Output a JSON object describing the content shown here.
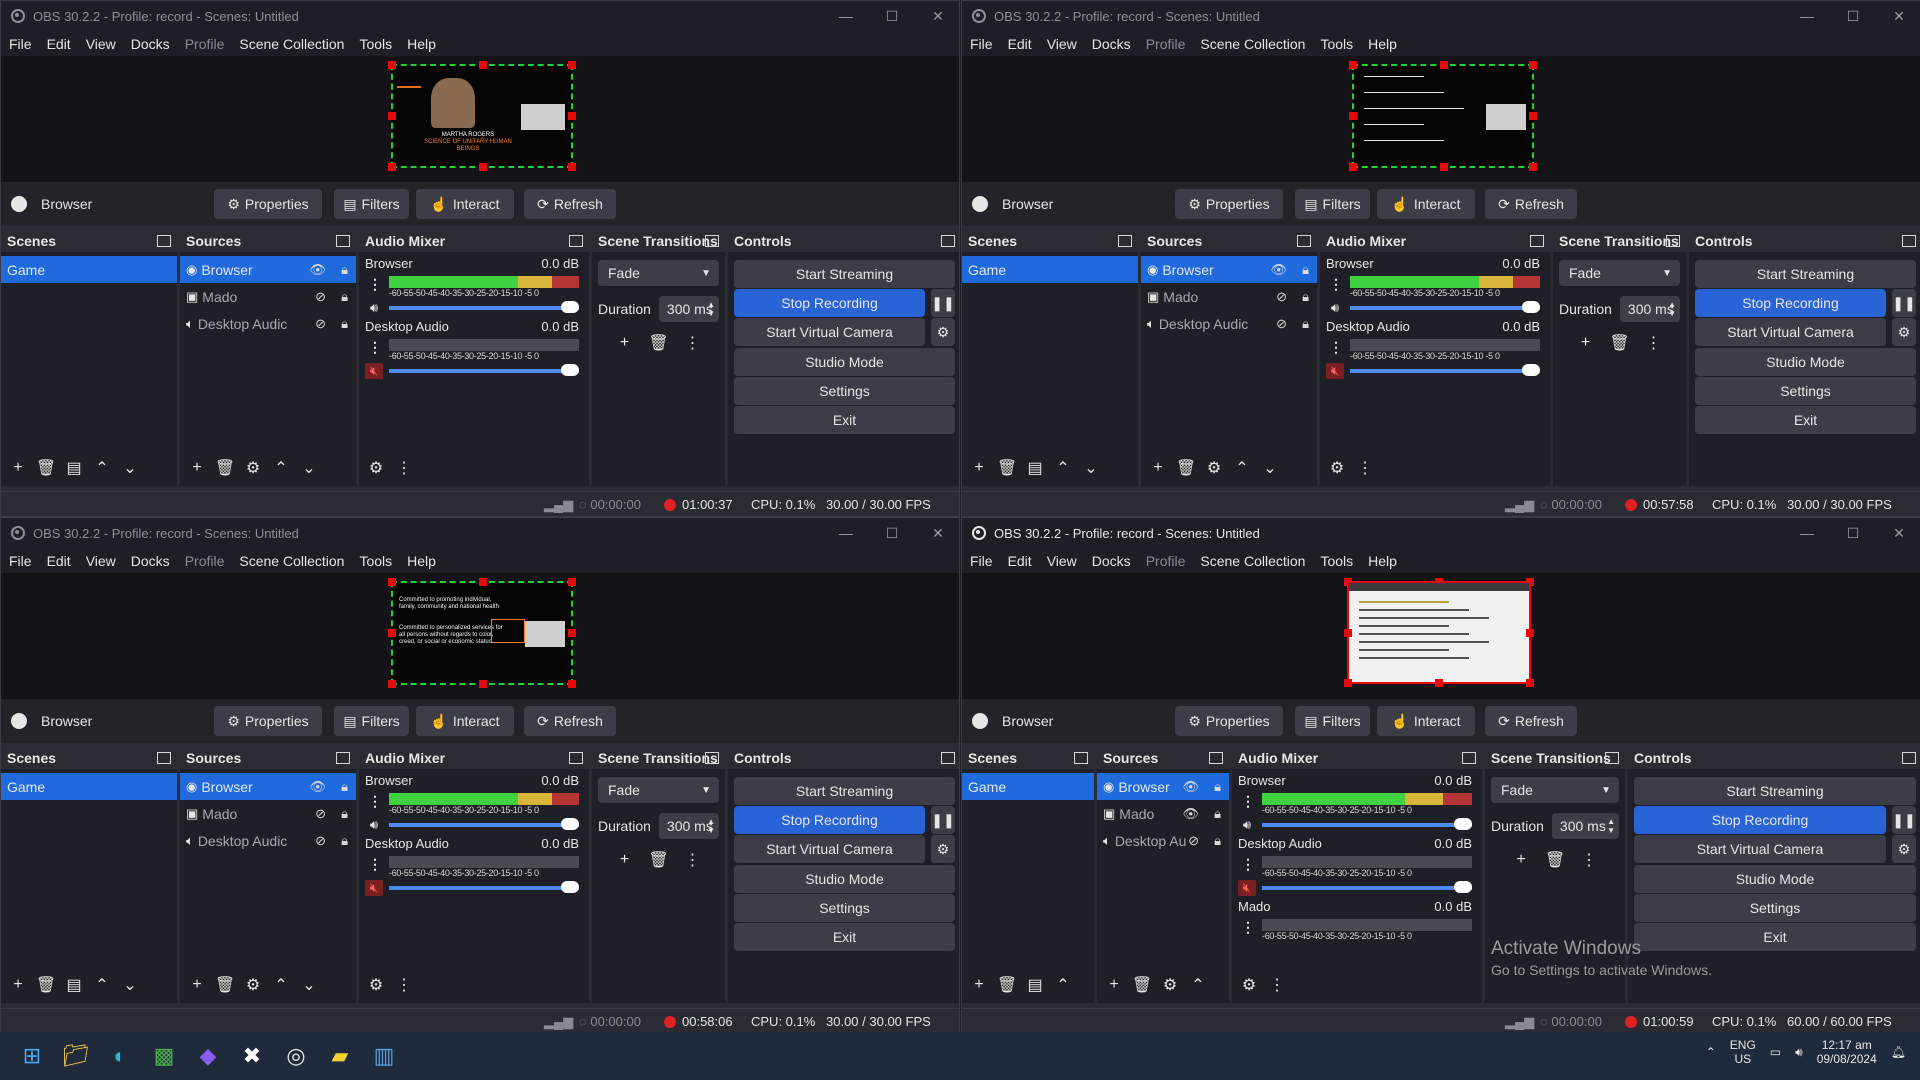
{
  "windows": [
    {
      "title": "OBS 30.2.2 - Profile: record - Scenes: Untitled",
      "menus": [
        "File",
        "Edit",
        "View",
        "Docks",
        "Profile",
        "Scene Collection",
        "Tools",
        "Help"
      ],
      "source_name": "Browser",
      "buttons": {
        "properties": "Properties",
        "filters": "Filters",
        "interact": "Interact",
        "refresh": "Refresh"
      },
      "docks": {
        "scenes": "Scenes",
        "sources": "Sources",
        "audio_mixer": "Audio Mixer",
        "scene_transitions": "Scene Transitions",
        "controls": "Controls"
      },
      "scenes": [
        "Game"
      ],
      "sources": [
        "Browser",
        "Mado",
        "Desktop Audic"
      ],
      "mixer": [
        {
          "name": "Browser",
          "db": "0.0 dB"
        },
        {
          "name": "Desktop Audio",
          "db": "0.0 dB"
        }
      ],
      "ticks": "-60-55-50-45-40-35-30-25-20-15-10 -5  0",
      "transition": "Fade",
      "duration_label": "Duration",
      "duration": "300 ms",
      "controls": [
        "Start Streaming",
        "Stop Recording",
        "Start Virtual Camera",
        "Studio Mode",
        "Settings",
        "Exit"
      ],
      "status": {
        "stream_time": "00:00:00",
        "rec_time": "01:00:37",
        "cpu": "CPU: 0.1%",
        "fps": "30.00 / 30.00 FPS"
      }
    },
    {
      "title": "OBS 30.2.2 - Profile: record - Scenes: Untitled",
      "menus": [
        "File",
        "Edit",
        "View",
        "Docks",
        "Profile",
        "Scene Collection",
        "Tools",
        "Help"
      ],
      "source_name": "Browser",
      "buttons": {
        "properties": "Properties",
        "filters": "Filters",
        "interact": "Interact",
        "refresh": "Refresh"
      },
      "docks": {
        "scenes": "Scenes",
        "sources": "Sources",
        "audio_mixer": "Audio Mixer",
        "scene_transitions": "Scene Transitions",
        "controls": "Controls"
      },
      "scenes": [
        "Game"
      ],
      "sources": [
        "Browser",
        "Mado",
        "Desktop Audic"
      ],
      "mixer": [
        {
          "name": "Browser",
          "db": "0.0 dB"
        },
        {
          "name": "Desktop Audio",
          "db": "0.0 dB"
        }
      ],
      "ticks": "-60-55-50-45-40-35-30-25-20-15-10 -5  0",
      "transition": "Fade",
      "duration_label": "Duration",
      "duration": "300 ms",
      "controls": [
        "Start Streaming",
        "Stop Recording",
        "Start Virtual Camera",
        "Studio Mode",
        "Settings",
        "Exit"
      ],
      "status": {
        "stream_time": "00:00:00",
        "rec_time": "00:57:58",
        "cpu": "CPU: 0.1%",
        "fps": "30.00 / 30.00 FPS"
      }
    },
    {
      "title": "OBS 30.2.2 - Profile: record - Scenes: Untitled",
      "menus": [
        "File",
        "Edit",
        "View",
        "Docks",
        "Profile",
        "Scene Collection",
        "Tools",
        "Help"
      ],
      "source_name": "Browser",
      "buttons": {
        "properties": "Properties",
        "filters": "Filters",
        "interact": "Interact",
        "refresh": "Refresh"
      },
      "docks": {
        "scenes": "Scenes",
        "sources": "Sources",
        "audio_mixer": "Audio Mixer",
        "scene_transitions": "Scene Transitions",
        "controls": "Controls"
      },
      "scenes": [
        "Game"
      ],
      "sources": [
        "Browser",
        "Mado",
        "Desktop Audic"
      ],
      "mixer": [
        {
          "name": "Browser",
          "db": "0.0 dB"
        },
        {
          "name": "Desktop Audio",
          "db": "0.0 dB"
        }
      ],
      "ticks": "-60-55-50-45-40-35-30-25-20-15-10 -5  0",
      "transition": "Fade",
      "duration_label": "Duration",
      "duration": "300 ms",
      "controls": [
        "Start Streaming",
        "Stop Recording",
        "Start Virtual Camera",
        "Studio Mode",
        "Settings",
        "Exit"
      ],
      "status": {
        "stream_time": "00:00:00",
        "rec_time": "00:58:06",
        "cpu": "CPU: 0.1%",
        "fps": "30.00 / 30.00 FPS"
      }
    },
    {
      "title": "OBS 30.2.2 - Profile: record - Scenes: Untitled",
      "menus": [
        "File",
        "Edit",
        "View",
        "Docks",
        "Profile",
        "Scene Collection",
        "Tools",
        "Help"
      ],
      "source_name": "Browser",
      "buttons": {
        "properties": "Properties",
        "filters": "Filters",
        "interact": "Interact",
        "refresh": "Refresh"
      },
      "docks": {
        "scenes": "Scenes",
        "sources": "Sources",
        "audio_mixer": "Audio Mixer",
        "scene_transitions": "Scene Transitions",
        "controls": "Controls"
      },
      "scenes": [
        "Game"
      ],
      "sources": [
        "Browser",
        "Mado",
        "Desktop Au"
      ],
      "mixer": [
        {
          "name": "Browser",
          "db": "0.0 dB"
        },
        {
          "name": "Desktop Audio",
          "db": "0.0 dB"
        },
        {
          "name": "Mado",
          "db": "0.0 dB"
        }
      ],
      "ticks": "-60-55-50-45-40-35-30-25-20-15-10 -5  0",
      "transition": "Fade",
      "duration_label": "Duration",
      "duration": "300 ms",
      "controls": [
        "Start Streaming",
        "Stop Recording",
        "Start Virtual Camera",
        "Studio Mode",
        "Settings",
        "Exit"
      ],
      "status": {
        "stream_time": "00:00:00",
        "rec_time": "01:00:59",
        "cpu": "CPU: 0.1%",
        "fps": "60.00 / 60.00 FPS"
      }
    }
  ],
  "preview_text": {
    "w1": [
      "MARTHA ROGERS",
      "SCIENCE OF UNITARY HUMAN BEINGS"
    ],
    "w3": [
      "Committed to promoting individual, family, community and national health",
      "Committed to personalized services for all persons without regards to color, creed, or social or economic status"
    ]
  },
  "watermark": {
    "title": "Activate Windows",
    "subtitle": "Go to Settings to activate Windows."
  },
  "taskbar": {
    "lang": "ENG",
    "region": "US",
    "time": "12:17 am",
    "date": "09/08/2024"
  },
  "colors": {
    "accent": "#2864d6",
    "selection": "#1f6bde",
    "record": "#e02121",
    "meter_green": "#3fd13f",
    "meter_yellow": "#d9b53a",
    "meter_red": "#d92e2e"
  }
}
